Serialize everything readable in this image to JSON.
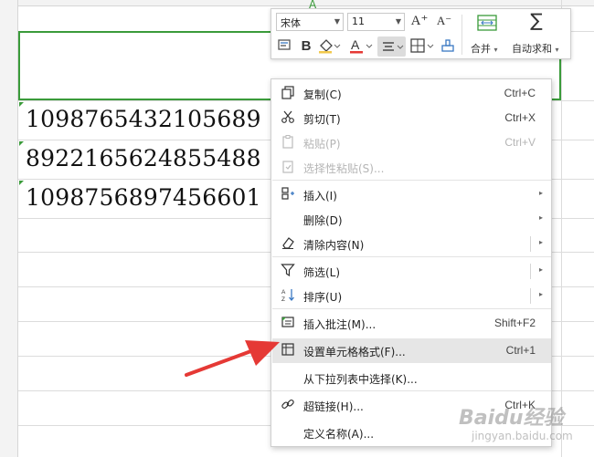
{
  "sheet": {
    "column_marker": "A",
    "cells": [
      "1098765432105689",
      "8922165624855488",
      "1098756897456601"
    ]
  },
  "mini_toolbar": {
    "font_name": "宋体",
    "font_size": "11",
    "increase_font_glyph": "A⁺",
    "decrease_font_glyph": "A⁻",
    "bold_glyph": "B",
    "font_color_glyph": "A",
    "merge_label": "合并",
    "autosum_label": "自动求和",
    "autosum_glyph": "∑"
  },
  "context_menu": {
    "items": [
      {
        "label": "复制(C)",
        "shortcut": "Ctrl+C",
        "icon": "copy-icon",
        "enabled": true
      },
      {
        "label": "剪切(T)",
        "shortcut": "Ctrl+X",
        "icon": "scissors-icon",
        "enabled": true
      },
      {
        "label": "粘贴(P)",
        "shortcut": "Ctrl+V",
        "icon": "paste-icon",
        "enabled": false
      },
      {
        "label": "选择性粘贴(S)...",
        "shortcut": "",
        "icon": "paste-special-icon",
        "enabled": false
      },
      {
        "label": "插入(I)",
        "shortcut": "",
        "icon": "insert-icon",
        "enabled": true,
        "submenu": true
      },
      {
        "label": "删除(D)",
        "shortcut": "",
        "icon": "",
        "enabled": true,
        "submenu": true
      },
      {
        "label": "清除内容(N)",
        "shortcut": "",
        "icon": "eraser-icon",
        "enabled": true,
        "submenu": true,
        "split": true
      },
      {
        "label": "筛选(L)",
        "shortcut": "",
        "icon": "filter-icon",
        "enabled": true,
        "submenu": true,
        "split": true
      },
      {
        "label": "排序(U)",
        "shortcut": "",
        "icon": "sort-icon",
        "enabled": true,
        "submenu": true,
        "split": true
      },
      {
        "label": "插入批注(M)...",
        "shortcut": "Shift+F2",
        "icon": "comment-icon",
        "enabled": true
      },
      {
        "label": "设置单元格格式(F)...",
        "shortcut": "Ctrl+1",
        "icon": "format-cells-icon",
        "enabled": true,
        "highlighted": true
      },
      {
        "label": "从下拉列表中选择(K)...",
        "shortcut": "",
        "icon": "",
        "enabled": true
      },
      {
        "label": "超链接(H)...",
        "shortcut": "Ctrl+K",
        "icon": "link-icon",
        "enabled": true
      },
      {
        "label": "定义名称(A)...",
        "shortcut": "",
        "icon": "",
        "enabled": true
      }
    ]
  },
  "watermark": {
    "text": "Baidu经验",
    "sub": "jingyan.baidu.com"
  },
  "colors": {
    "selection_border": "#3a9b3a",
    "annotation_arrow": "#e53935",
    "highlight_row": "#e6e6e6"
  }
}
